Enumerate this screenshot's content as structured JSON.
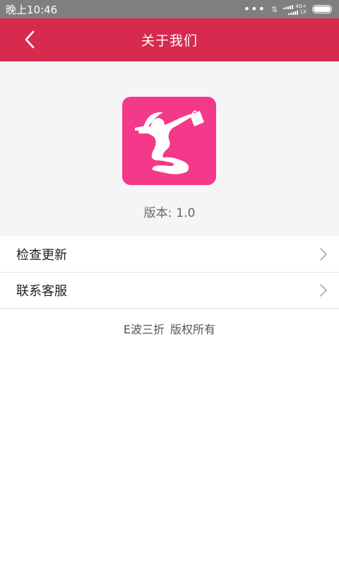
{
  "status_bar": {
    "time": "晚上10:46",
    "dots": "•••",
    "net_arrows": "⇅",
    "network_label_top": "4G+",
    "network_label_bottom": "1X"
  },
  "app_bar": {
    "title": "关于我们",
    "back_icon": "chevron-left-icon"
  },
  "app_info": {
    "logo_icon": "woman-shopping-bag-logo",
    "version_label": "版本:",
    "version_value": "1.0"
  },
  "menu": {
    "items": [
      {
        "label": "检查更新"
      },
      {
        "label": "联系客服"
      }
    ]
  },
  "footer": {
    "brand": "E波三折",
    "rights": "版权所有"
  },
  "colors": {
    "status_bar": "#7f7f7f",
    "app_bar": "#d62b4f",
    "logo_bg": "#f4388a",
    "header_bg": "#f5f5f5"
  }
}
